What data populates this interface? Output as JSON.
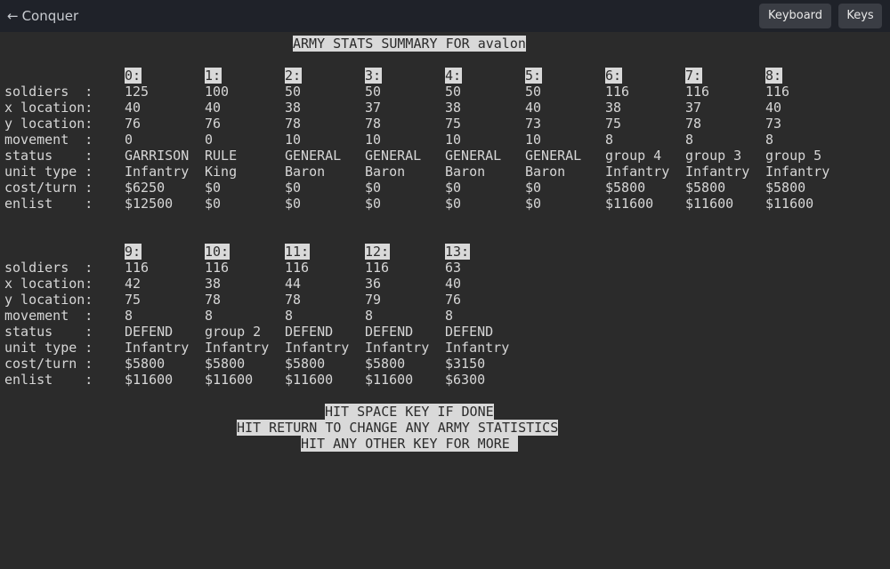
{
  "topbar": {
    "back_label": "Conquer",
    "back_arrow": "←",
    "keyboard_label": "Keyboard",
    "keys_label": "Keys"
  },
  "terminal": {
    "title": "ARMY STATS SUMMARY FOR avalon",
    "row_labels": [
      "soldiers  :",
      "x location:",
      "y location:",
      "movement  :",
      "status    :",
      "unit type :",
      "cost/turn :",
      "enlist    :"
    ],
    "blocks": [
      {
        "armies": [
          {
            "id": "0:",
            "soldiers": "125",
            "x": "40",
            "y": "76",
            "movement": "0",
            "status": "GARRISON",
            "unit_type": "Infantry",
            "cost": "$6250",
            "enlist": "$12500"
          },
          {
            "id": "1:",
            "soldiers": "100",
            "x": "40",
            "y": "76",
            "movement": "0",
            "status": "RULE",
            "unit_type": "King",
            "cost": "$0",
            "enlist": "$0"
          },
          {
            "id": "2:",
            "soldiers": "50",
            "x": "38",
            "y": "78",
            "movement": "10",
            "status": "GENERAL",
            "unit_type": "Baron",
            "cost": "$0",
            "enlist": "$0"
          },
          {
            "id": "3:",
            "soldiers": "50",
            "x": "37",
            "y": "78",
            "movement": "10",
            "status": "GENERAL",
            "unit_type": "Baron",
            "cost": "$0",
            "enlist": "$0"
          },
          {
            "id": "4:",
            "soldiers": "50",
            "x": "38",
            "y": "75",
            "movement": "10",
            "status": "GENERAL",
            "unit_type": "Baron",
            "cost": "$0",
            "enlist": "$0"
          },
          {
            "id": "5:",
            "soldiers": "50",
            "x": "40",
            "y": "73",
            "movement": "10",
            "status": "GENERAL",
            "unit_type": "Baron",
            "cost": "$0",
            "enlist": "$0"
          },
          {
            "id": "6:",
            "soldiers": "116",
            "x": "38",
            "y": "75",
            "movement": "8",
            "status": "group 4",
            "unit_type": "Infantry",
            "cost": "$5800",
            "enlist": "$11600"
          },
          {
            "id": "7:",
            "soldiers": "116",
            "x": "37",
            "y": "78",
            "movement": "8",
            "status": "group 3",
            "unit_type": "Infantry",
            "cost": "$5800",
            "enlist": "$11600"
          },
          {
            "id": "8:",
            "soldiers": "116",
            "x": "40",
            "y": "73",
            "movement": "8",
            "status": "group 5",
            "unit_type": "Infantry",
            "cost": "$5800",
            "enlist": "$11600"
          }
        ]
      },
      {
        "armies": [
          {
            "id": "9:",
            "soldiers": "116",
            "x": "42",
            "y": "75",
            "movement": "8",
            "status": "DEFEND",
            "unit_type": "Infantry",
            "cost": "$5800",
            "enlist": "$11600"
          },
          {
            "id": "10:",
            "soldiers": "116",
            "x": "38",
            "y": "78",
            "movement": "8",
            "status": "group 2",
            "unit_type": "Infantry",
            "cost": "$5800",
            "enlist": "$11600"
          },
          {
            "id": "11:",
            "soldiers": "116",
            "x": "44",
            "y": "78",
            "movement": "8",
            "status": "DEFEND",
            "unit_type": "Infantry",
            "cost": "$5800",
            "enlist": "$11600"
          },
          {
            "id": "12:",
            "soldiers": "116",
            "x": "36",
            "y": "79",
            "movement": "8",
            "status": "DEFEND",
            "unit_type": "Infantry",
            "cost": "$5800",
            "enlist": "$11600"
          },
          {
            "id": "13:",
            "soldiers": "63",
            "x": "40",
            "y": "76",
            "movement": "8",
            "status": "DEFEND",
            "unit_type": "Infantry",
            "cost": "$3150",
            "enlist": "$6300"
          }
        ]
      }
    ],
    "prompts": [
      "HIT SPACE KEY IF DONE",
      "HIT RETURN TO CHANGE ANY ARMY STATISTICS",
      "HIT ANY OTHER KEY FOR MORE "
    ]
  }
}
